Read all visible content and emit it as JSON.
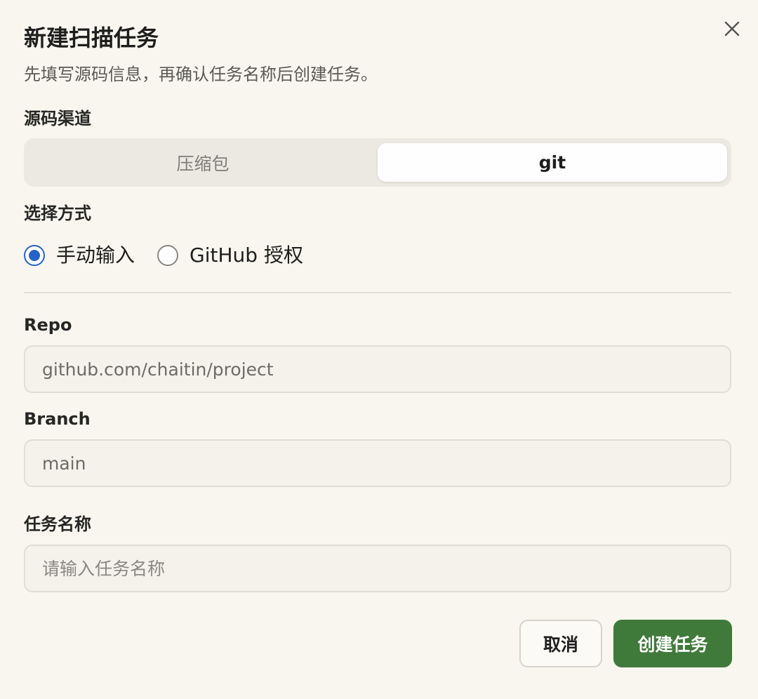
{
  "dialog": {
    "title": "新建扫描任务",
    "subtitle": "先填写源码信息，再确认任务名称后创建任务。",
    "close_icon": "close-icon"
  },
  "source_channel": {
    "label": "源码渠道",
    "options": [
      "压缩包",
      "git"
    ],
    "selected": "git"
  },
  "select_method": {
    "label": "选择方式",
    "options": [
      "手动输入",
      "GitHub 授权"
    ],
    "selected": "手动输入"
  },
  "repo": {
    "label": "Repo",
    "value": "github.com/chaitin/project"
  },
  "branch": {
    "label": "Branch",
    "value": "main"
  },
  "task_name": {
    "label": "任务名称",
    "value": "",
    "placeholder": "请输入任务名称"
  },
  "actions": {
    "cancel_label": "取消",
    "create_label": "创建任务"
  },
  "colors": {
    "background": "#f8f6ef",
    "accent_radio": "#2563c9",
    "primary_button": "#3f7a3a"
  }
}
